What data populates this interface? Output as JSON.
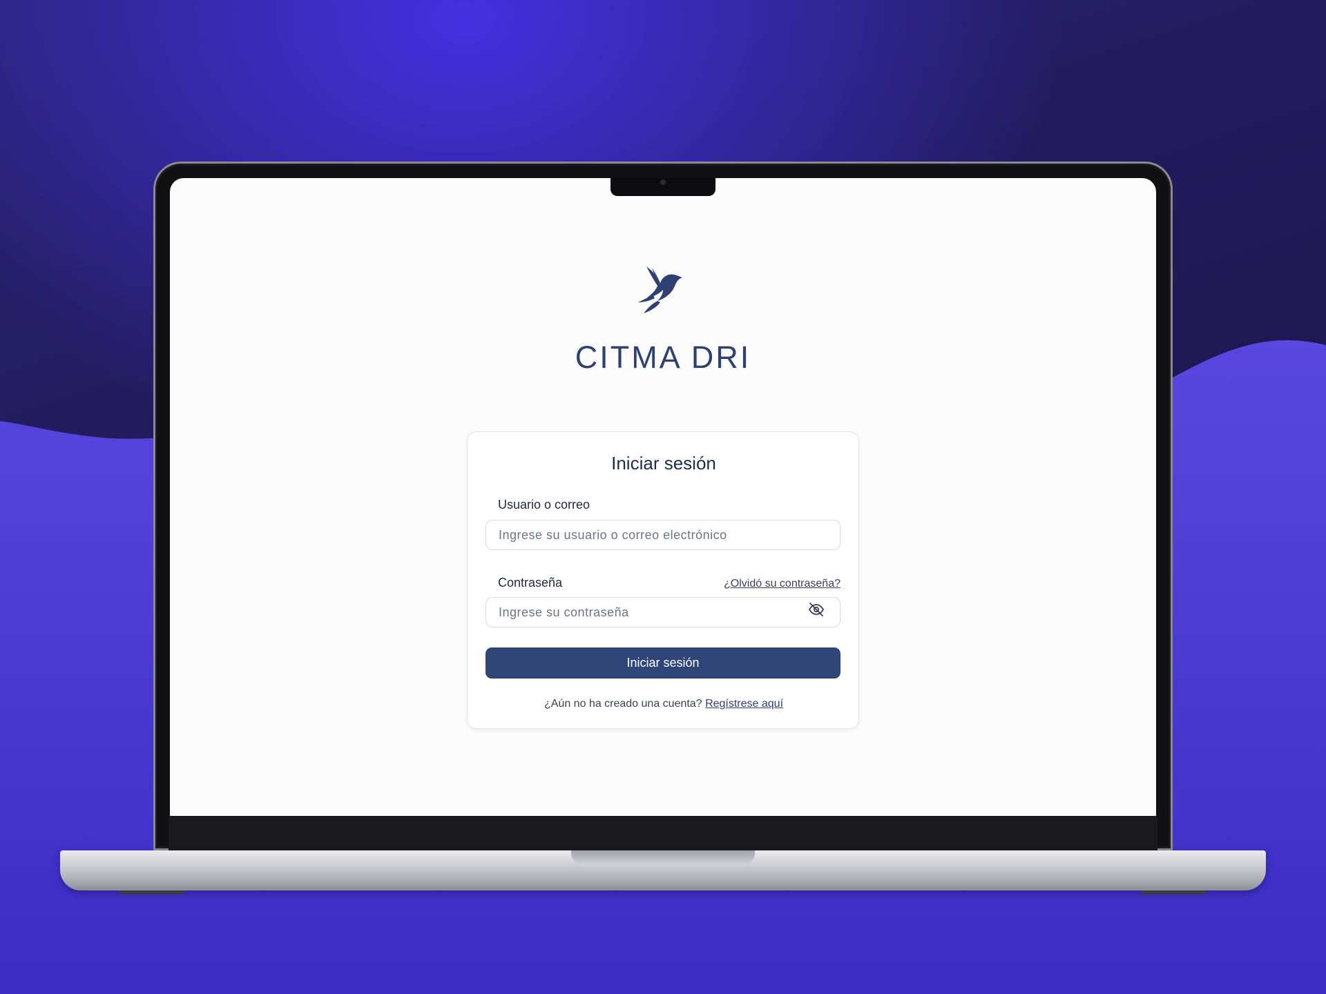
{
  "app": {
    "title": "CITMA DRI",
    "logo_icon": "bird-logo-icon"
  },
  "colors": {
    "primary": "#2f4577",
    "title_text": "#2f4172",
    "background_purple": "#4a3ad6",
    "background_dark": "#211a5c"
  },
  "login": {
    "heading": "Iniciar sesión",
    "username_label": "Usuario o correo",
    "username_placeholder": "Ingrese su usuario o correo electrónico",
    "password_label": "Contraseña",
    "password_placeholder": "Ingrese su contraseña",
    "forgot_password": "¿Olvidó su contraseña?",
    "submit_label": "Iniciar sesión",
    "signup_prompt": "¿Aún no ha creado una cuenta?",
    "signup_link": "Regístrese aquí",
    "toggle_visibility_icon": "eye-off-icon"
  }
}
